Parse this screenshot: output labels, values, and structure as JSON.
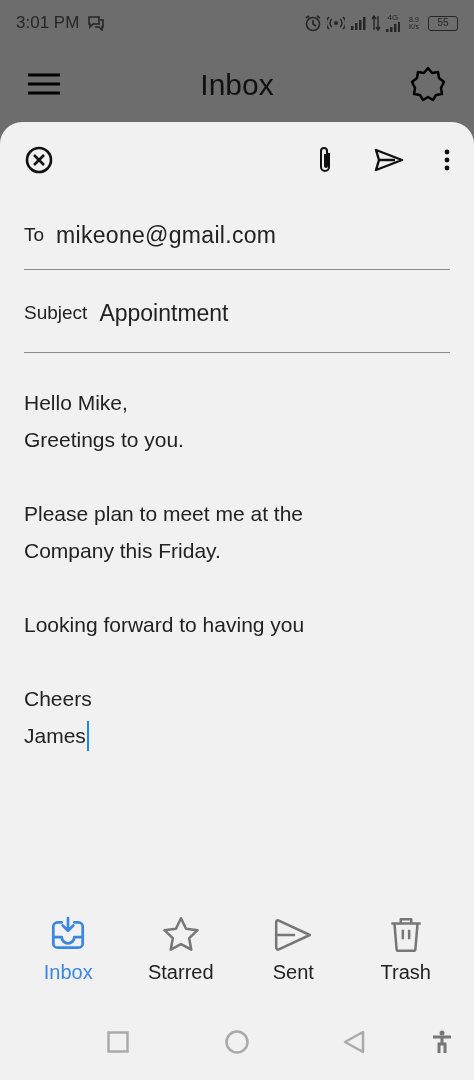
{
  "status_bar": {
    "time": "3:01 PM",
    "network": "4G",
    "speed": "8.9",
    "speed_unit": "K/s",
    "battery": "55"
  },
  "app_bar": {
    "title": "Inbox"
  },
  "compose": {
    "to_label": "To",
    "to": "mikeone@gmail.com",
    "subject_label": "Subject",
    "subject": "Appointment",
    "body": [
      [
        "Hello Mike,",
        "Greetings to you."
      ],
      [
        "Please plan to meet me at the",
        "Company this Friday."
      ],
      [
        "Looking forward to having you"
      ],
      [
        "Cheers",
        "James"
      ]
    ]
  },
  "bottom_nav": [
    {
      "kind": "inbox",
      "label": "Inbox",
      "selected": true
    },
    {
      "kind": "star",
      "label": "Starred",
      "selected": false
    },
    {
      "kind": "sent",
      "label": "Sent",
      "selected": false
    },
    {
      "kind": "trash",
      "label": "Trash",
      "selected": false
    }
  ]
}
